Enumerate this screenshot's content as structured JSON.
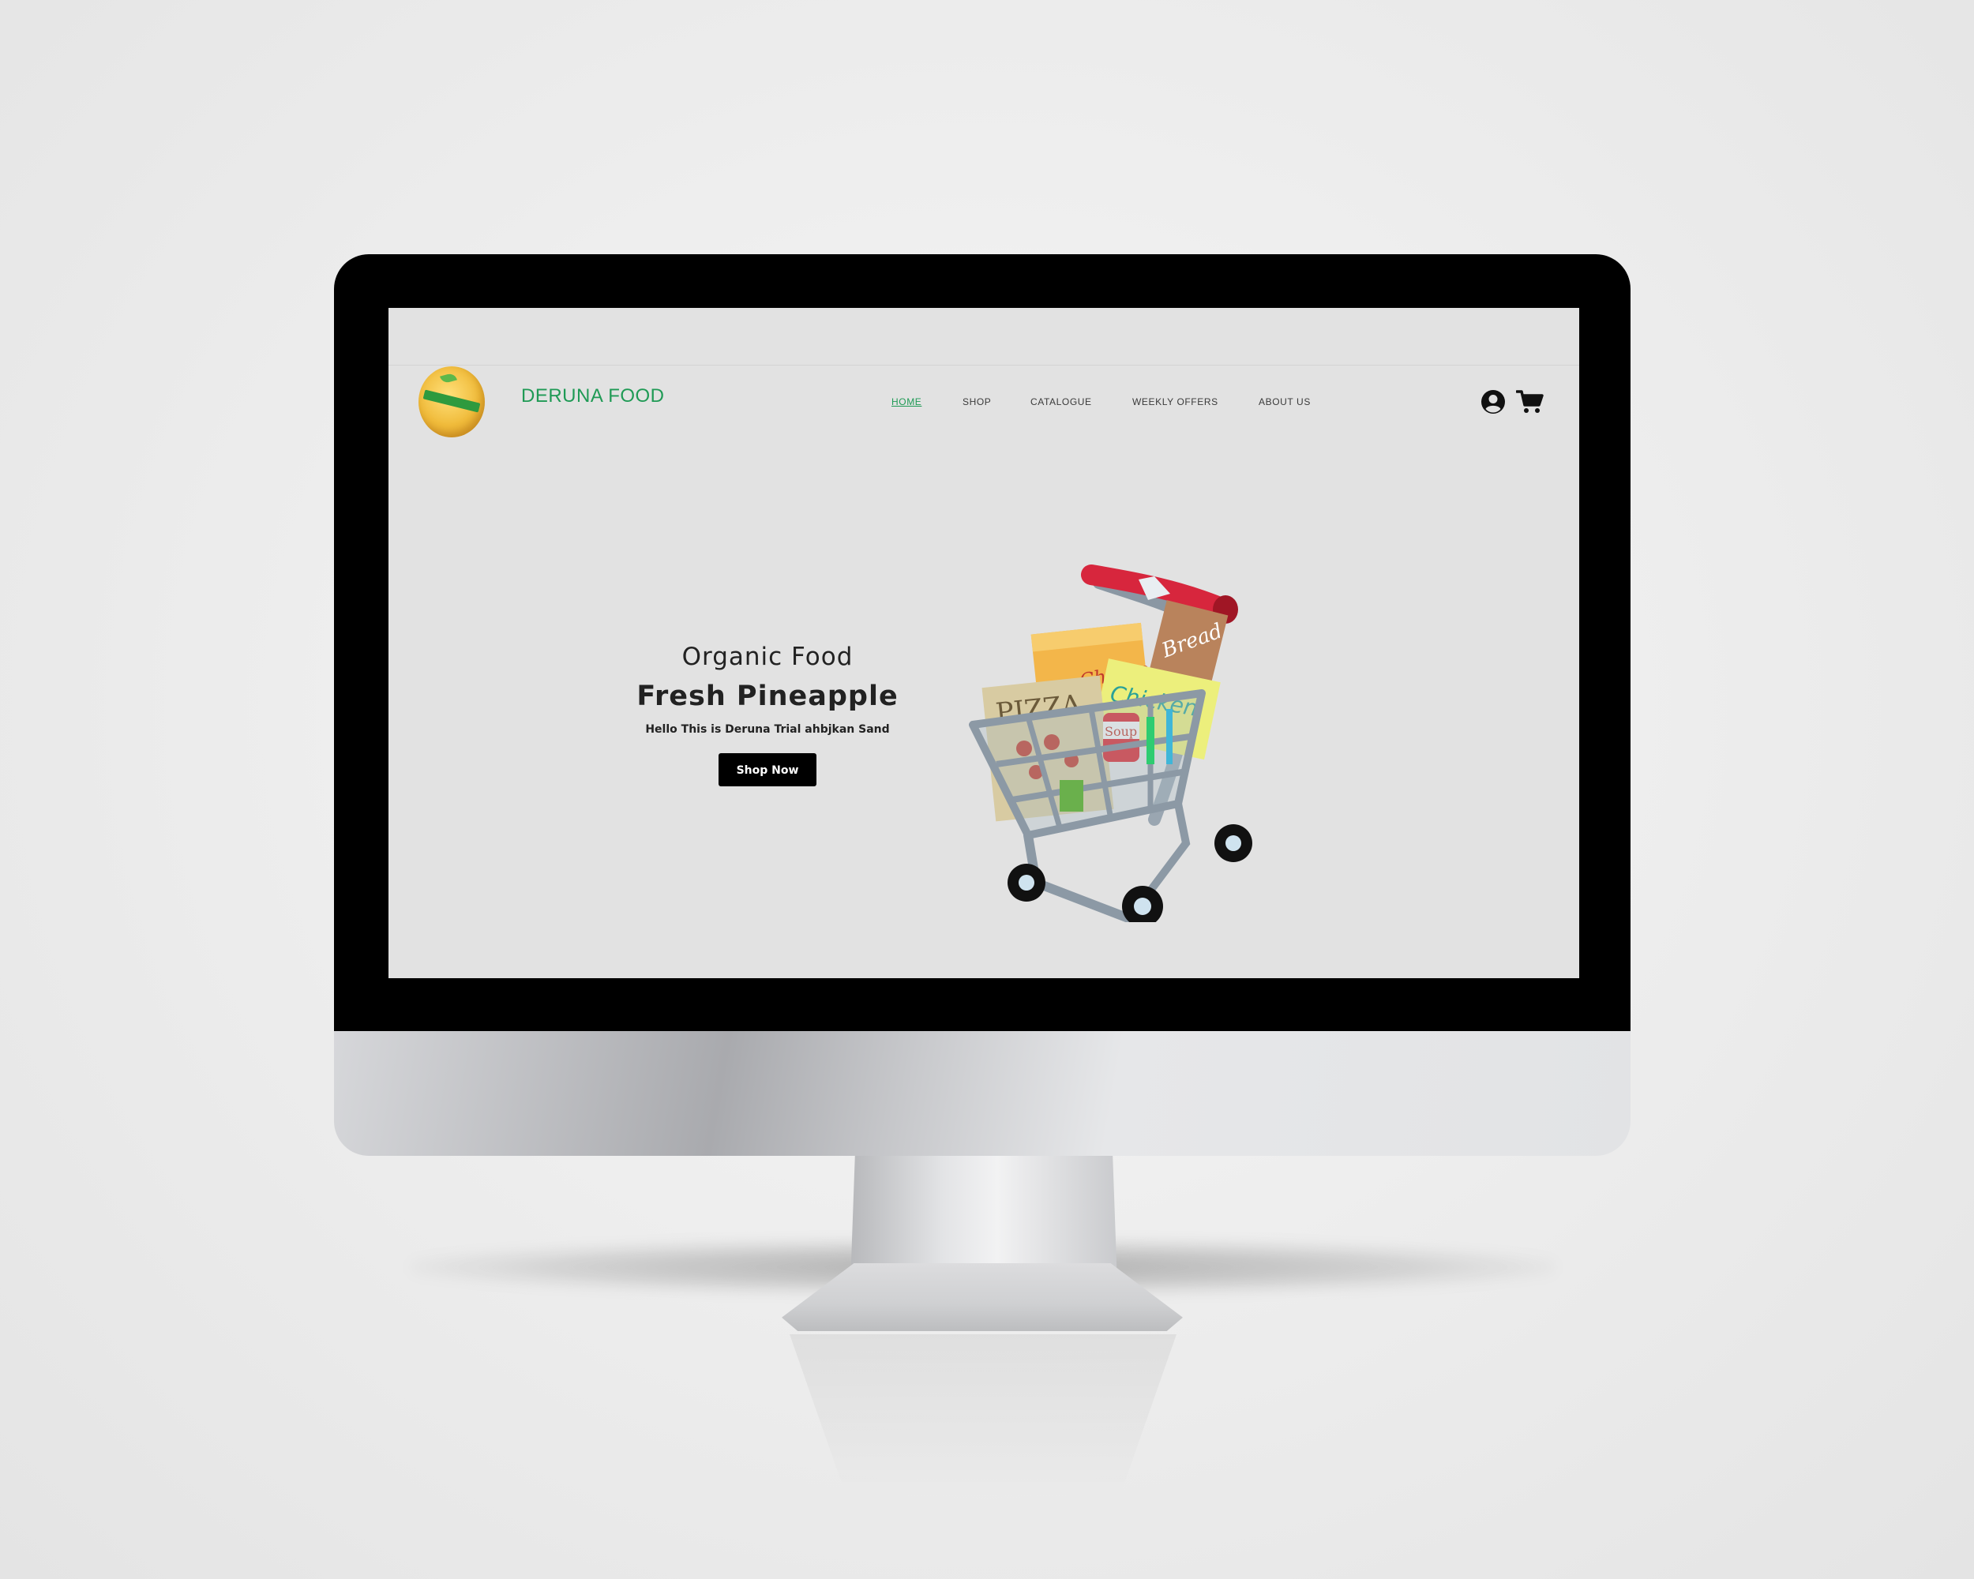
{
  "brand": {
    "name": "DERUNA FOOD",
    "color": "#1f9a55"
  },
  "nav": {
    "items": [
      {
        "label": "HOME",
        "active": true
      },
      {
        "label": "SHOP"
      },
      {
        "label": "CATALOGUE"
      },
      {
        "label": "WEEKLY OFFERS"
      },
      {
        "label": "ABOUT US"
      }
    ]
  },
  "header_icons": [
    "user-circle-icon",
    "shopping-cart-icon"
  ],
  "hero": {
    "subtitle": "Organic Food",
    "title": "Fresh Pineapple",
    "description": "Hello This is Deruna Trial ahbjkan Sand",
    "button_label": "Shop Now"
  },
  "illustration": {
    "labels": {
      "pizza": "PIZZA",
      "cheese": "Cheese",
      "bread": "Bread",
      "chicken": "Chicken",
      "soup": "Soup"
    }
  },
  "colors": {
    "accent": "#1f9a55",
    "button": "#000000",
    "screen_bg": "#e2e2e2"
  }
}
